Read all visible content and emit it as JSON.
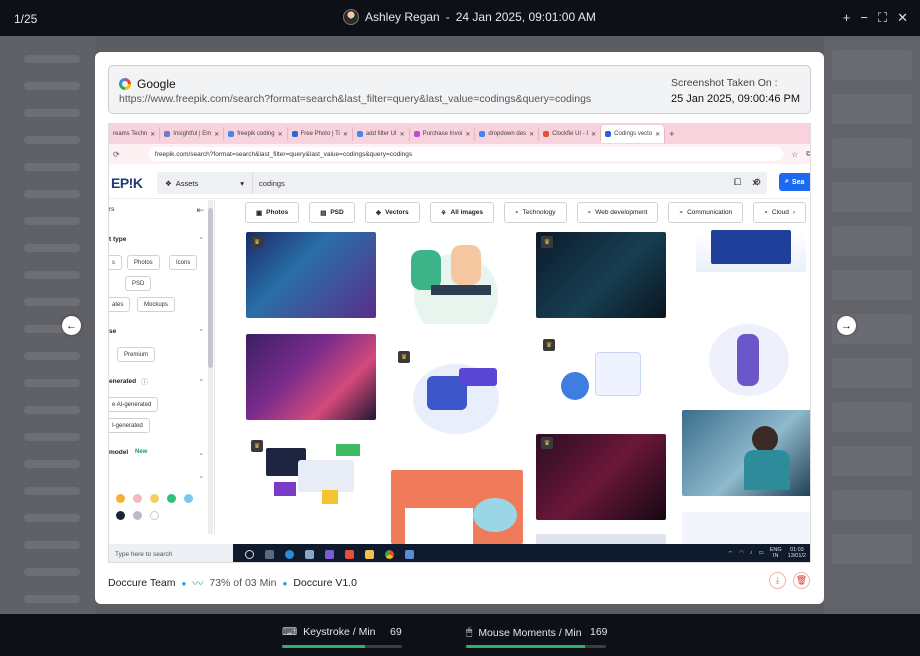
{
  "topbar": {
    "counter": "1/25",
    "user": "Ashley Regan",
    "separator": "-",
    "datetime": "24 Jan 2025, 09:01:00 AM",
    "controls": [
      "+",
      "−",
      "⛶",
      "✕"
    ]
  },
  "card": {
    "browser_name": "Google",
    "url": "https://www.freepik.com/search?format=search&last_filter=query&last_value=codings&query=codings",
    "screenshot_label": "Screenshot Taken On :",
    "screenshot_date": "25 Jan 2025, 09:00:46 PM"
  },
  "browser": {
    "tabs": [
      {
        "label": "reams Techn"
      },
      {
        "label": "Insightful | Em"
      },
      {
        "label": "freepik coding"
      },
      {
        "label": "Free Photo | Ti"
      },
      {
        "label": "add filter UI"
      },
      {
        "label": "Purchase Invoi"
      },
      {
        "label": "dropdown des"
      },
      {
        "label": "Clockfie UI - I"
      },
      {
        "label": "Codings vecto"
      }
    ],
    "address": "freepik.com/search?format=search&last_filter=query&last_value=codings&query=codings"
  },
  "freepik": {
    "logo": "EP!K",
    "assets_label": "Assets",
    "query": "codings",
    "search_button": "Sea",
    "filters_title": "rs",
    "sections": {
      "asset_type": "t type",
      "license": "se",
      "ai": "enerated",
      "model": "model",
      "model_badge": "New"
    },
    "asset_chips": [
      "s",
      "Photos",
      "Icons",
      "PSD",
      "ates",
      "Mockups"
    ],
    "license_chips": [
      "Premium"
    ],
    "ai_chips": [
      "e AI-generated",
      "I-generated"
    ],
    "color_dots": [
      "#f2b233",
      "#f5b6c0",
      "#f4cf68",
      "#35c07a",
      "#7fc4ef",
      "#1b2433",
      "#b7bec6",
      "#ffffff"
    ],
    "categories": [
      {
        "label": "Photos",
        "icon": "image-icon"
      },
      {
        "label": "PSD",
        "icon": "psd-icon"
      },
      {
        "label": "Vectors",
        "icon": "vector-icon"
      },
      {
        "label": "All images",
        "icon": "all-images-icon"
      },
      {
        "label": "Technology",
        "icon": "search-icon"
      },
      {
        "label": "Web development",
        "icon": "search-icon"
      },
      {
        "label": "Communication",
        "icon": "search-icon"
      },
      {
        "label": "Cloud",
        "icon": "search-icon"
      }
    ]
  },
  "taskbar": {
    "search_placeholder": "Type here to search",
    "lang": "ENG",
    "region": "IN",
    "time": "01:03",
    "date": "13/01/2"
  },
  "footer": {
    "team": "Doccure Team",
    "activity": "73% of 03 Min",
    "project": "Doccure V1.0"
  },
  "stats": {
    "keystroke_label": "Keystroke / Min",
    "keystroke_value": "69",
    "keystroke_progress": 0.69,
    "mouse_label": "Mouse Moments / Min",
    "mouse_value": "169",
    "mouse_progress": 0.85
  },
  "colors": {
    "accent_green": "#29b36a",
    "accent_blue": "#1c6af0",
    "tab_strip": "#f8d3dd"
  }
}
